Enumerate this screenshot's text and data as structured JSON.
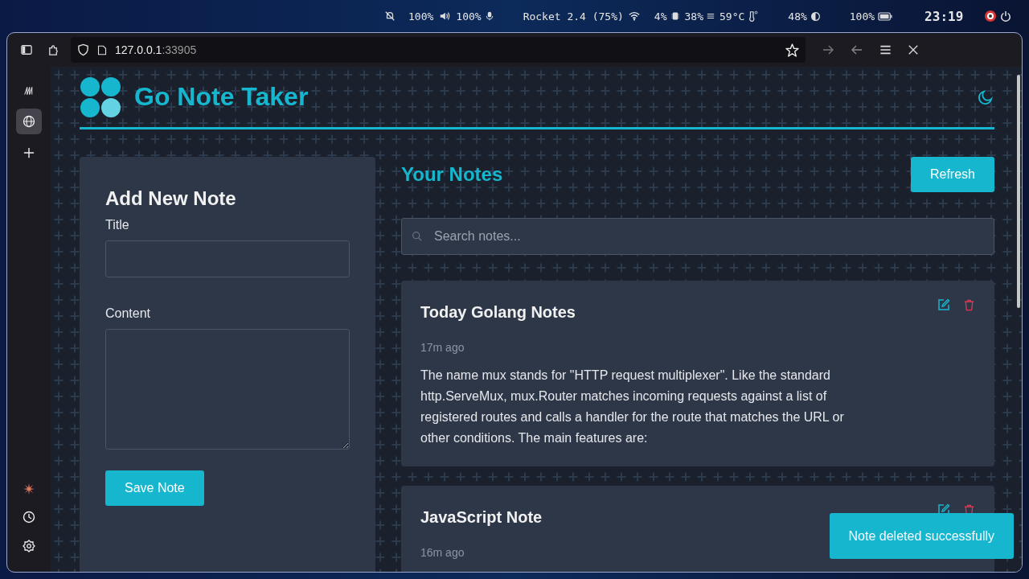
{
  "status_bar": {
    "brightness": "100%",
    "volume": "100%",
    "media": "Rocket 2.4 (75%)",
    "cpu": "4%",
    "memory": "38%",
    "temperature": "59°C",
    "display": "48%",
    "battery": "100%",
    "clock": "23:19"
  },
  "browser": {
    "url_host": "127.0.0.1",
    "url_port": ":33905"
  },
  "app": {
    "title": "Go Note Taker",
    "form": {
      "heading": "Add New Note",
      "title_label": "Title",
      "content_label": "Content",
      "save_button": "Save Note"
    },
    "notes_heading": "Your Notes",
    "refresh_button": "Refresh",
    "search": {
      "placeholder": "Search notes..."
    },
    "notes": [
      {
        "title": "Today Golang Notes",
        "time": "17m ago",
        "content": "The name mux stands for \"HTTP request multiplexer\". Like the standard http.ServeMux, mux.Router matches incoming requests against a list of registered routes and calls a handler for the route that matches the URL or other conditions. The main features are:"
      },
      {
        "title": "JavaScript Note",
        "time": "16m ago"
      }
    ],
    "toast": "Note deleted successfully"
  }
}
